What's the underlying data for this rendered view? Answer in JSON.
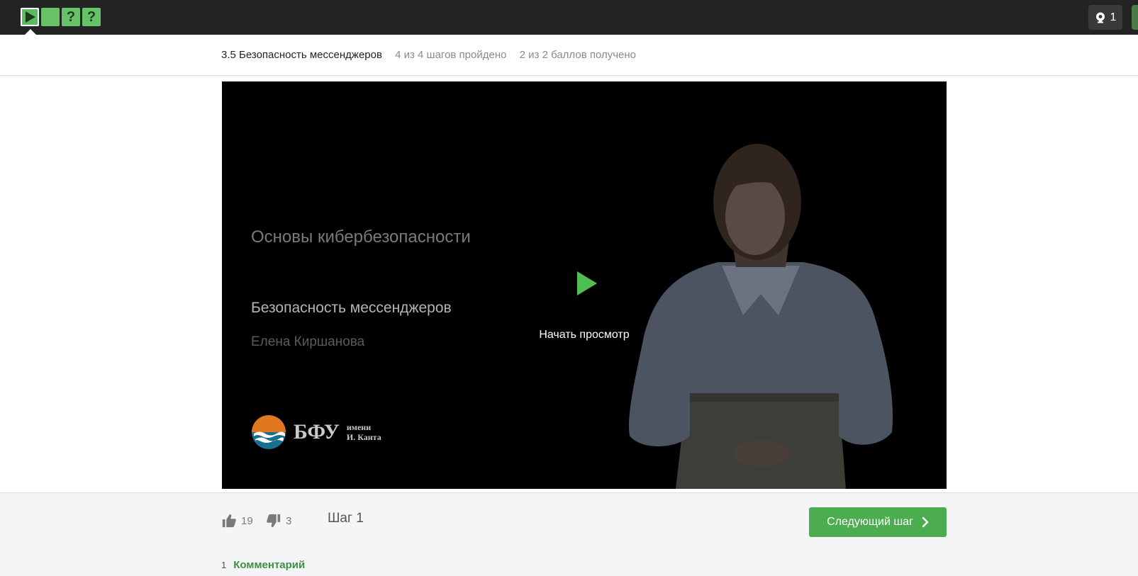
{
  "topbar": {
    "steps": [
      {
        "type": "video",
        "icon": "play-icon",
        "status": "passed",
        "label": ""
      },
      {
        "type": "text",
        "icon": "",
        "status": "passed",
        "label": ""
      },
      {
        "type": "quiz",
        "icon": "",
        "status": "passed",
        "label": "?"
      },
      {
        "type": "quiz",
        "icon": "",
        "status": "passed",
        "label": "?"
      }
    ],
    "notifications": {
      "icon": "trophy-icon",
      "count": "1"
    }
  },
  "lesson": {
    "title": "3.5 Безопасность мессенджеров",
    "progress": "4 из 4 шагов пройдено",
    "score": "2 из 2 баллов  получено"
  },
  "video": {
    "course_name": "Основы кибербезопасности",
    "lecture_name": "Безопасность мессенджеров",
    "lecturer": "Елена Киршанова",
    "logo_abbr": "БФУ",
    "logo_sub_line1": "имени",
    "logo_sub_line2": "И. Канта",
    "start_label": "Начать просмотр"
  },
  "footer": {
    "likes": "19",
    "dislikes": "3",
    "step_label": "Шаг 1",
    "next_label": "Следующий шаг",
    "comments_count": "1",
    "comments_label": "Комментарий"
  },
  "colors": {
    "accent_green": "#4cad50",
    "tile_green": "#66c169",
    "topbar_bg": "#232323",
    "link_green": "#3f8f43"
  }
}
